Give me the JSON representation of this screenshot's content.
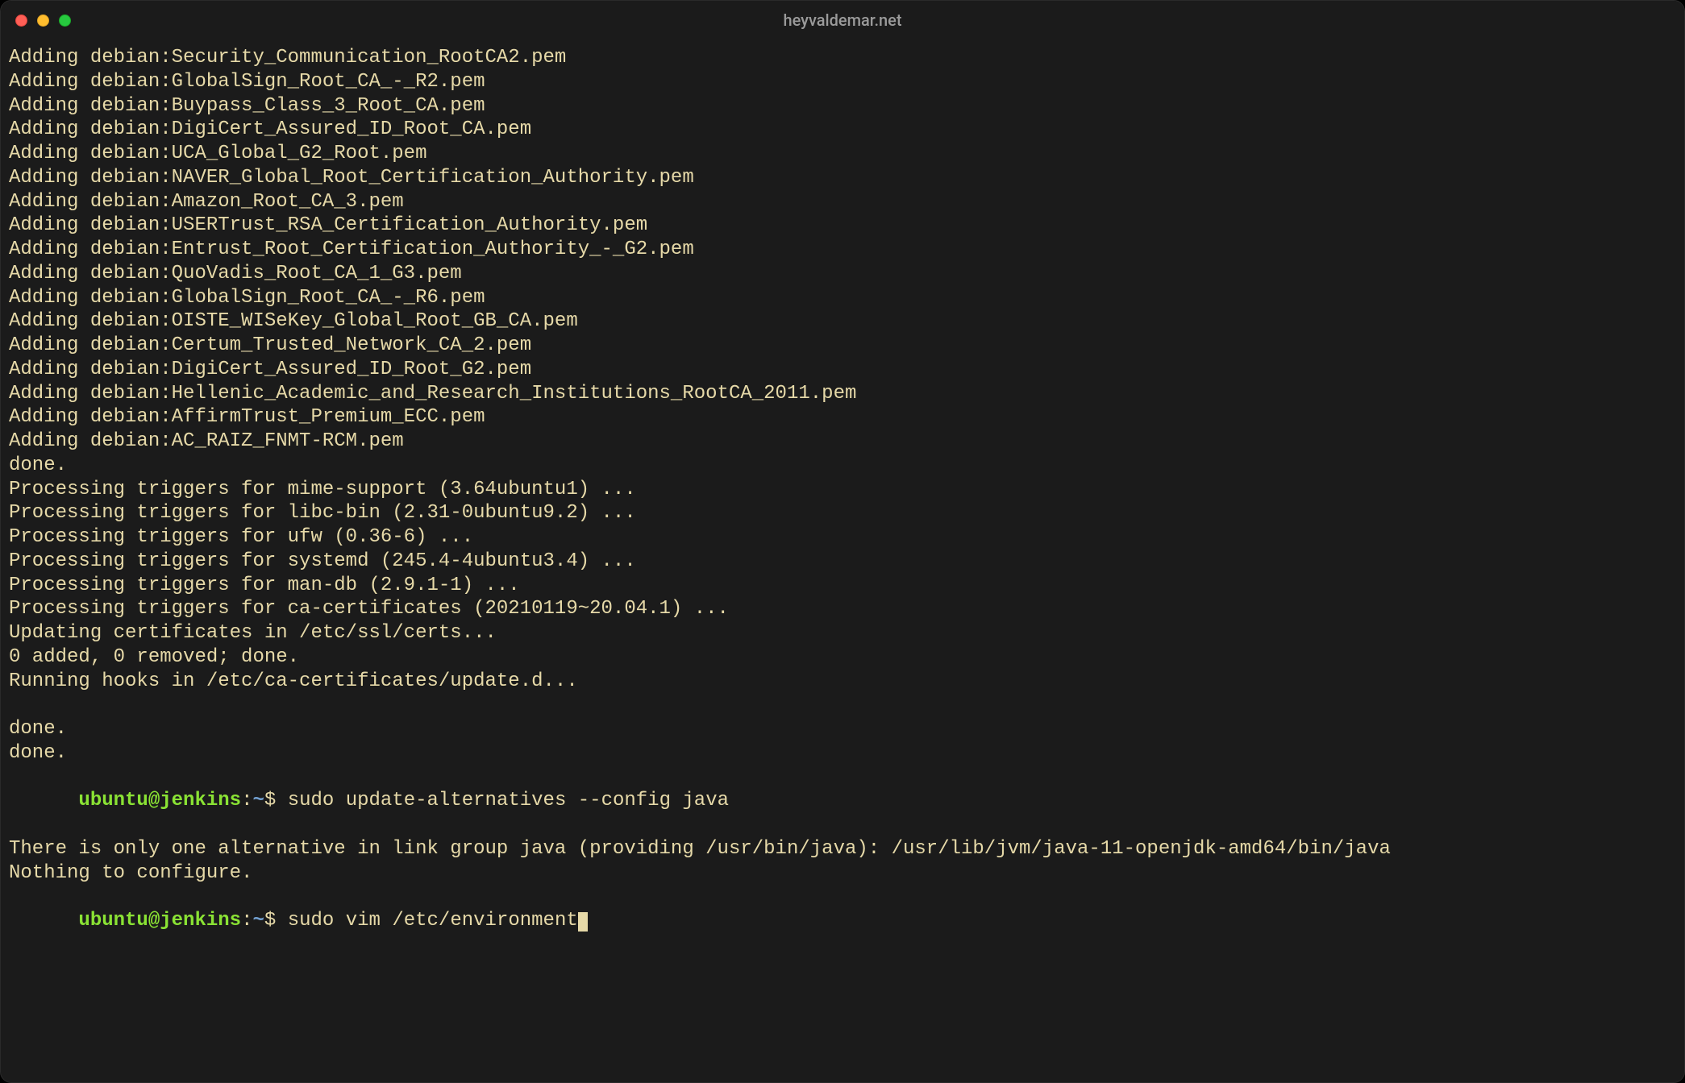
{
  "window": {
    "title": "heyvaldemar.net"
  },
  "output_lines": [
    "Adding debian:Security_Communication_RootCA2.pem",
    "Adding debian:GlobalSign_Root_CA_-_R2.pem",
    "Adding debian:Buypass_Class_3_Root_CA.pem",
    "Adding debian:DigiCert_Assured_ID_Root_CA.pem",
    "Adding debian:UCA_Global_G2_Root.pem",
    "Adding debian:NAVER_Global_Root_Certification_Authority.pem",
    "Adding debian:Amazon_Root_CA_3.pem",
    "Adding debian:USERTrust_RSA_Certification_Authority.pem",
    "Adding debian:Entrust_Root_Certification_Authority_-_G2.pem",
    "Adding debian:QuoVadis_Root_CA_1_G3.pem",
    "Adding debian:GlobalSign_Root_CA_-_R6.pem",
    "Adding debian:OISTE_WISeKey_Global_Root_GB_CA.pem",
    "Adding debian:Certum_Trusted_Network_CA_2.pem",
    "Adding debian:DigiCert_Assured_ID_Root_G2.pem",
    "Adding debian:Hellenic_Academic_and_Research_Institutions_RootCA_2011.pem",
    "Adding debian:AffirmTrust_Premium_ECC.pem",
    "Adding debian:AC_RAIZ_FNMT-RCM.pem",
    "done.",
    "Processing triggers for mime-support (3.64ubuntu1) ...",
    "Processing triggers for libc-bin (2.31-0ubuntu9.2) ...",
    "Processing triggers for ufw (0.36-6) ...",
    "Processing triggers for systemd (245.4-4ubuntu3.4) ...",
    "Processing triggers for man-db (2.9.1-1) ...",
    "Processing triggers for ca-certificates (20210119~20.04.1) ...",
    "Updating certificates in /etc/ssl/certs...",
    "0 added, 0 removed; done.",
    "Running hooks in /etc/ca-certificates/update.d...",
    "",
    "done.",
    "done."
  ],
  "prompts": [
    {
      "user": "ubuntu",
      "host": "jenkins",
      "path": "~",
      "command": "sudo update-alternatives --config java",
      "cursor": false
    }
  ],
  "post_output": [
    "There is only one alternative in link group java (providing /usr/bin/java): /usr/lib/jvm/java-11-openjdk-amd64/bin/java",
    "Nothing to configure."
  ],
  "active_prompt": {
    "user": "ubuntu",
    "host": "jenkins",
    "path": "~",
    "command": "sudo vim /etc/environment",
    "cursor": true
  }
}
